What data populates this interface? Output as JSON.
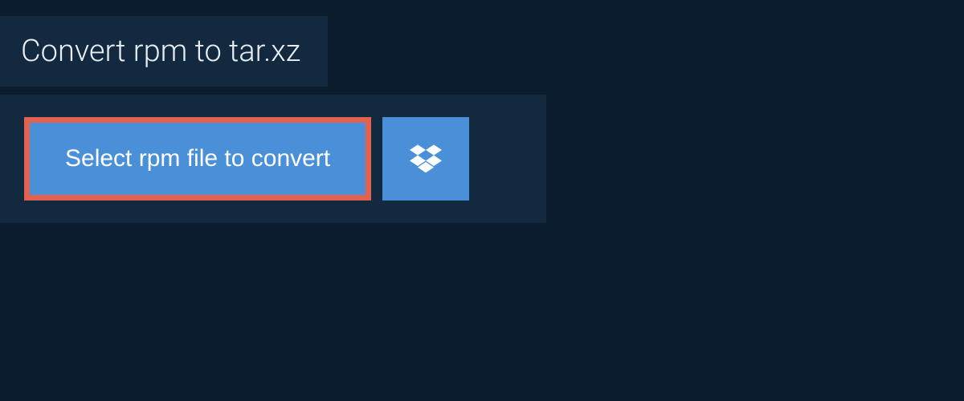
{
  "header": {
    "title": "Convert rpm to tar.xz"
  },
  "actions": {
    "select_file_label": "Select rpm file to convert",
    "dropbox_icon": "dropbox-icon"
  },
  "colors": {
    "background": "#0a1c2e",
    "panel": "#13293f",
    "button": "#4a90d9",
    "highlight_border": "#e2614f",
    "text_light": "#e8eef4",
    "text_white": "#ffffff"
  }
}
